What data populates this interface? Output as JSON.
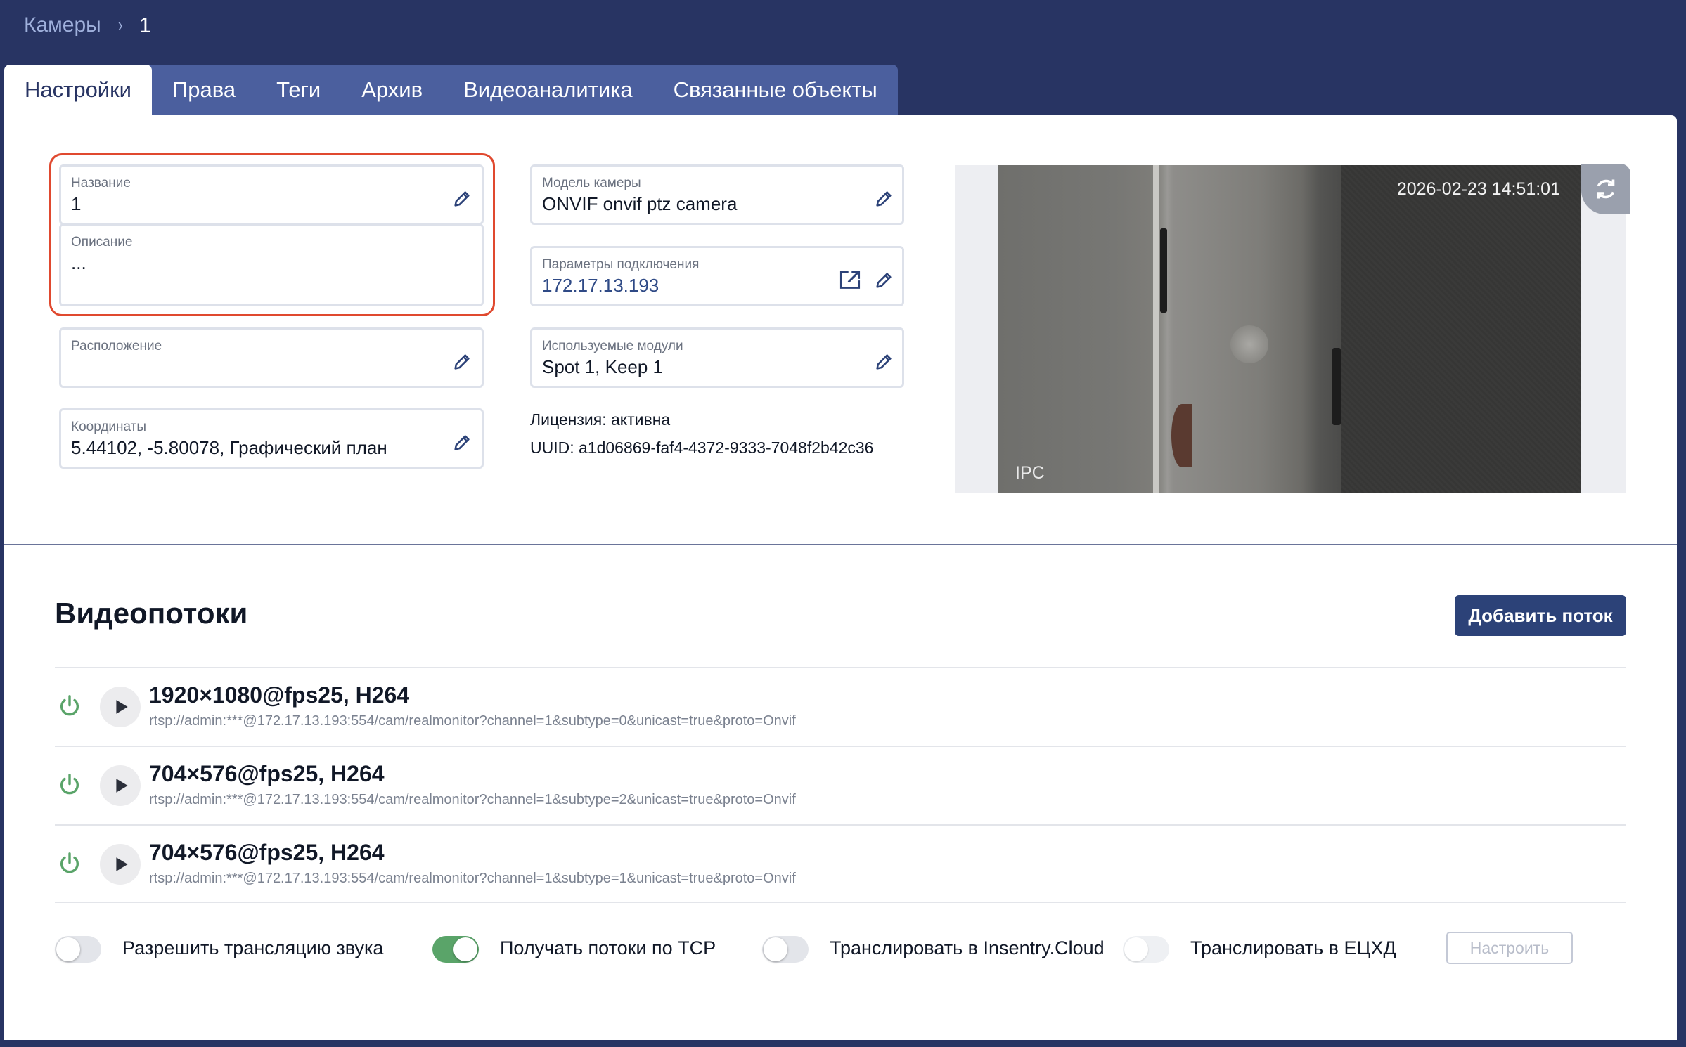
{
  "breadcrumb": {
    "parent": "Камеры",
    "separator": "›",
    "current": "1"
  },
  "tabs": [
    {
      "label": "Настройки",
      "active": true
    },
    {
      "label": "Права"
    },
    {
      "label": "Теги"
    },
    {
      "label": "Архив"
    },
    {
      "label": "Видеоаналитика"
    },
    {
      "label": "Связанные объекты"
    }
  ],
  "fields": {
    "name": {
      "label": "Название",
      "value": "1"
    },
    "description": {
      "label": "Описание",
      "value": "..."
    },
    "location": {
      "label": "Расположение",
      "value": ""
    },
    "coordinates": {
      "label": "Координаты",
      "value": "5.44102, -5.80078, Графический план"
    },
    "model": {
      "label": "Модель камеры",
      "value": "ONVIF onvif ptz camera"
    },
    "connection": {
      "label": "Параметры подключения",
      "value": "172.17.13.193"
    },
    "modules": {
      "label": "Используемые модули",
      "value": "Spot 1, Keep 1"
    }
  },
  "license": "Лицензия: активна",
  "uuid": "UUID: a1d06869-faf4-4372-9333-7048f2b42c36",
  "preview": {
    "timestamp": "2026-02-23 14:51:01",
    "camera_label": "IPC"
  },
  "streams_section": {
    "title": "Видеопотоки",
    "add_button": "Добавить поток",
    "streams": [
      {
        "title": "1920×1080@fps25, H264",
        "url": "rtsp://admin:***@172.17.13.193:554/cam/realmonitor?channel=1&subtype=0&unicast=true&proto=Onvif"
      },
      {
        "title": "704×576@fps25, H264",
        "url": "rtsp://admin:***@172.17.13.193:554/cam/realmonitor?channel=1&subtype=2&unicast=true&proto=Onvif"
      },
      {
        "title": "704×576@fps25, H264",
        "url": "rtsp://admin:***@172.17.13.193:554/cam/realmonitor?channel=1&subtype=1&unicast=true&proto=Onvif"
      }
    ]
  },
  "toggles": [
    {
      "label": "Разрешить трансляцию звука",
      "on": false
    },
    {
      "label": "Получать потоки по TCP",
      "on": true
    },
    {
      "label": "Транслировать в Insentry.Cloud",
      "on": false
    },
    {
      "label": "Транслировать в ЕЦХД",
      "on": false,
      "disabled": true
    }
  ],
  "configure_button": "Настроить",
  "colors": {
    "header_bg": "#283463",
    "tab_bar": "#4b5f9e",
    "accent": "#2c4278",
    "power_on": "#5aa469",
    "highlight": "#e0492f"
  },
  "icons": [
    "pencil-icon",
    "external-link-icon",
    "refresh-icon",
    "power-icon",
    "play-icon"
  ]
}
